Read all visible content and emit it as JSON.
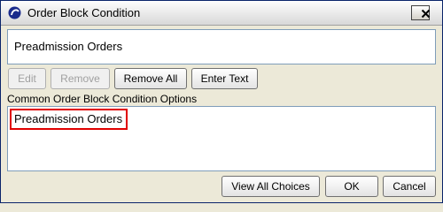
{
  "window": {
    "title": "Order Block Condition"
  },
  "icons": {
    "app": "app-logo-icon",
    "close": "close-icon"
  },
  "selected_condition": {
    "value": "Preadmission Orders"
  },
  "toolbar": {
    "edit_label": "Edit",
    "remove_label": "Remove",
    "remove_all_label": "Remove All",
    "enter_text_label": "Enter Text"
  },
  "options": {
    "label": "Common Order Block Condition Options",
    "items": [
      {
        "label": "Preadmission Orders",
        "highlighted": true
      }
    ]
  },
  "footer": {
    "view_all_label": "View All Choices",
    "ok_label": "OK",
    "cancel_label": "Cancel"
  },
  "colors": {
    "highlight_border": "#e00000",
    "title_border": "#0a246a"
  }
}
